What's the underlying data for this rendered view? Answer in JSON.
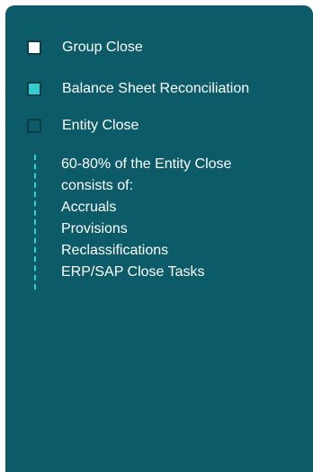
{
  "legend": {
    "items": [
      {
        "label": "Group Close",
        "color": "#ffffff",
        "state": "selected-white"
      },
      {
        "label": "Balance Sheet Reconciliation",
        "color": "#2fd0cf",
        "state": "filled-teal"
      },
      {
        "label": "Entity Close",
        "color": "#0b5c68",
        "state": "unfilled"
      }
    ]
  },
  "detail": {
    "accent_color": "#2fd0cf",
    "lines": [
      "60-80% of the Entity Close",
      "consists of:",
      "Accruals",
      "Provisions",
      "Reclassifications",
      "ERP/SAP Close Tasks"
    ]
  },
  "colors": {
    "card_background": "#0b5c68",
    "text": "#ffffff"
  }
}
